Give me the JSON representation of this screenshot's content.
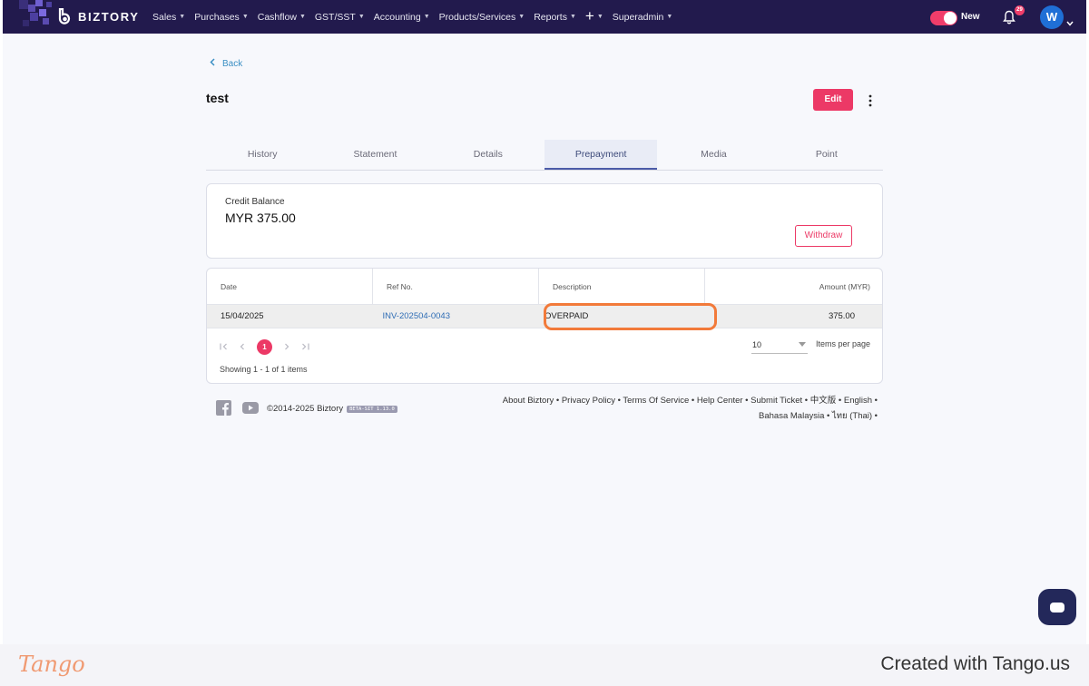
{
  "app": {
    "brand": "BIZTORY",
    "nav": [
      "Sales",
      "Purchases",
      "Cashflow",
      "GST/SST",
      "Accounting",
      "Products/Services",
      "Reports",
      "Superadmin"
    ],
    "toggle_label": "New",
    "notification_count": "29",
    "avatar_initial": "W"
  },
  "page": {
    "back_label": "Back",
    "title": "test",
    "edit_label": "Edit",
    "tabs": [
      "History",
      "Statement",
      "Details",
      "Prepayment",
      "Media",
      "Point"
    ],
    "active_tab": "Prepayment"
  },
  "credit": {
    "label": "Credit Balance",
    "value": "MYR 375.00",
    "withdraw_label": "Withdraw"
  },
  "table": {
    "columns": [
      "Date",
      "Ref No.",
      "Description",
      "Amount (MYR)"
    ],
    "rows": [
      {
        "date": "15/04/2025",
        "ref": "INV-202504-0043",
        "description": "OVERPAID",
        "amount": "375.00"
      }
    ],
    "pager": {
      "current_page": "1",
      "per_page": "10",
      "per_page_label": "Items per page",
      "showing": "Showing 1 - 1 of 1 items"
    }
  },
  "footer": {
    "copyright": "©2014-2025 Biztory",
    "version": "BETA-SIT 1.13.0",
    "links_line1": "About Biztory • Privacy Policy • Terms Of Service • Help Center • Submit Ticket • 中文版 • English •",
    "links_line2": "Bahasa Malaysia • ไทย (Thai) •"
  },
  "tango": {
    "logo": "Tango",
    "credit": "Created with Tango.us"
  },
  "colors": {
    "navbar": "#221a4d",
    "accent": "#ec3966",
    "link": "#2f6db5",
    "highlight": "#f27a3a"
  }
}
